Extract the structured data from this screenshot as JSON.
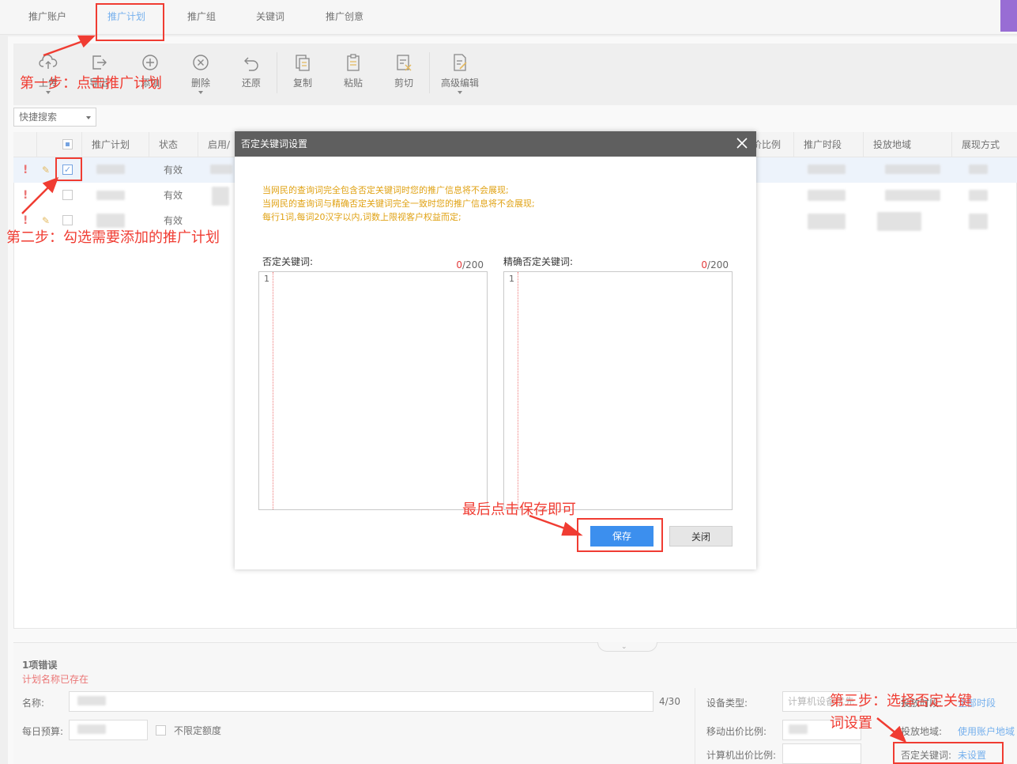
{
  "top_tabs": [
    "推广账户",
    "推广计划",
    "推广组",
    "关键词",
    "推广创意"
  ],
  "toolbar": {
    "upload": "上传",
    "export": "导出",
    "add": "添加",
    "delete": "删除",
    "restore": "还原",
    "copy": "复制",
    "paste": "粘贴",
    "cut": "剪切",
    "advanced_edit": "高级编辑"
  },
  "quick_search": "快捷搜索",
  "table": {
    "headers": [
      "推广计划",
      "状态",
      "启用/",
      "价比例",
      "推广时段",
      "投放地域",
      "展现方式"
    ],
    "rows": [
      {
        "status": "有效",
        "checked": true
      },
      {
        "status": "有效",
        "checked": false
      },
      {
        "status": "有效",
        "checked": false
      }
    ]
  },
  "modal": {
    "title": "否定关键词设置",
    "tips": [
      "当网民的查询词完全包含否定关键词时您的推广信息将不会展现;",
      "当网民的查询词与精确否定关键词完全一致时您的推广信息将不会展现;",
      "每行1词,每词20汉字以内,词数上限视客户权益而定;"
    ],
    "left_label": "否定关键词:",
    "right_label": "精确否定关键词:",
    "count_used": "0",
    "count_max": "/200",
    "line_number": "1",
    "save": "保存",
    "close": "关闭"
  },
  "bottom": {
    "error_title": "1项错误",
    "error_msg": "计划名称已存在",
    "name_label": "名称:",
    "name_count": "4/30",
    "budget_label": "每日预算:",
    "unlimited": "不限定额度",
    "device_label": "设备类型:",
    "device_value": "计算机设备优先",
    "mobile_ratio_label": "移动出价比例:",
    "pc_ratio_label": "计算机出价比例:",
    "schedule_label": "投放时段:",
    "schedule_value": "全部时段",
    "region_label": "投放地域:",
    "region_value": "使用账户地域",
    "negative_label": "否定关键词:",
    "negative_value": "未设置"
  },
  "annotations": {
    "step1": "第一步：点击推广计划",
    "step2": "第二步：勾选需要添加的推广计划",
    "step3_line1": "第三步：选择否定关键",
    "step3_line2": "词设置",
    "final": "最后点击保存即可"
  },
  "colors": {
    "accent": "#3a8ee6",
    "annotation": "#f03c32",
    "tip": "#e0a214",
    "save_button": "#3c8fee"
  }
}
